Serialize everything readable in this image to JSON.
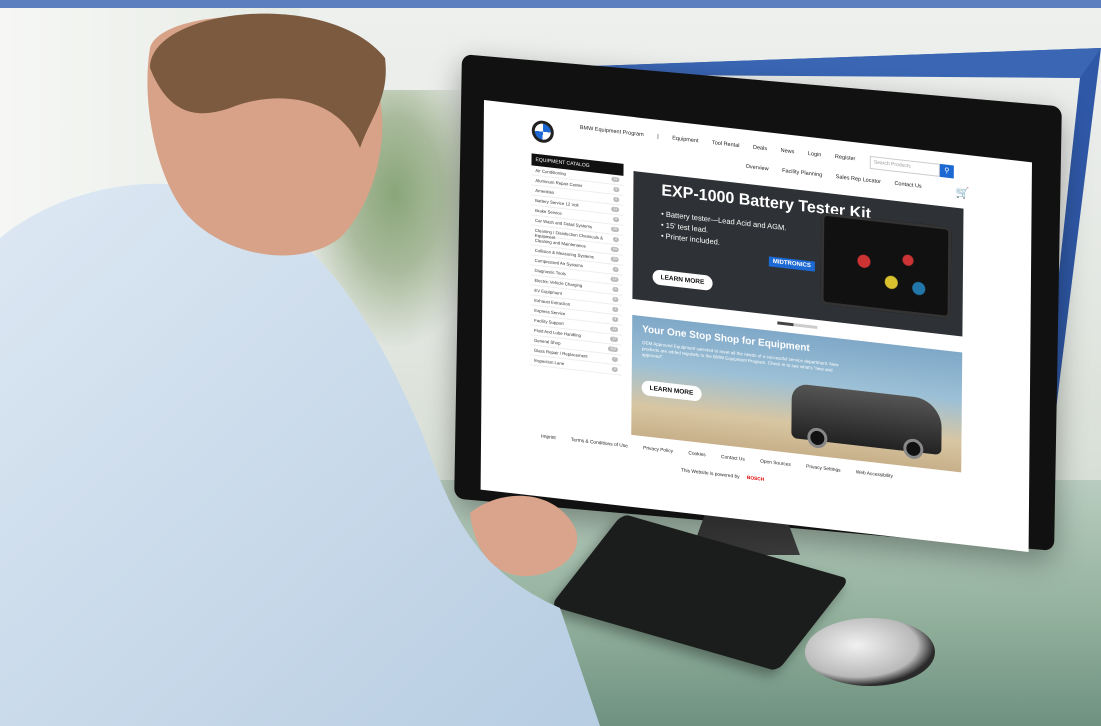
{
  "colors": {
    "accent": "#1c69d4",
    "frame": "#5b7fbf",
    "hero_dark": "#2e3135"
  },
  "site": {
    "nav_primary": [
      "BMW Equipment Program",
      "|",
      "Equipment",
      "Tool Rental",
      "Deals",
      "News",
      "Login",
      "Register"
    ],
    "search_placeholder": "Search Products",
    "search_icon": "search-icon",
    "nav_secondary": [
      "Overview",
      "Facility Planning",
      "Sales Rep Locator",
      "Contact Us"
    ],
    "cart_icon": "cart-icon"
  },
  "catalog": {
    "title": "EQUIPMENT CATALOG",
    "items": [
      {
        "label": "Air Conditioning",
        "count": "22"
      },
      {
        "label": "Aluminum Repair Center",
        "count": "9"
      },
      {
        "label": "Amenities",
        "count": "6"
      },
      {
        "label": "Battery Service 12 Volt",
        "count": "11"
      },
      {
        "label": "Brake Service",
        "count": "8"
      },
      {
        "label": "Car Wash and Detail Systems",
        "count": "25"
      },
      {
        "label": "Cleaning / Disinfection Chemicals & Equipment",
        "count": "2"
      },
      {
        "label": "Cleaning and Maintenance",
        "count": "44"
      },
      {
        "label": "Collision & Measuring Systems",
        "count": "23"
      },
      {
        "label": "Compressed Air Systems",
        "count": "4"
      },
      {
        "label": "Diagnostic Tools",
        "count": "12"
      },
      {
        "label": "Electric Vehicle Charging",
        "count": "6"
      },
      {
        "label": "EV Equipment",
        "count": "8"
      },
      {
        "label": "Exhaust Extraction",
        "count": "2"
      },
      {
        "label": "Express Service",
        "count": "9"
      },
      {
        "label": "Facility Support",
        "count": "11"
      },
      {
        "label": "Fluid And Lube Handling",
        "count": "17"
      },
      {
        "label": "General Shop",
        "count": "112"
      },
      {
        "label": "Glass Repair / Replacement",
        "count": "7"
      },
      {
        "label": "Inspection Lane",
        "count": "2"
      }
    ]
  },
  "hero_battery": {
    "title": "EXP-1000 Battery Tester Kit",
    "bullets": [
      "Battery tester—Lead Acid and AGM.",
      "15' test lead.",
      "Printer included."
    ],
    "brand": "MIDTRONICS",
    "cta": "LEARN MORE"
  },
  "hero_shop": {
    "title": "Your One Stop Shop for Equipment",
    "text": "OEM Approved Equipment selected to meet all the needs of a successful service department. New products are added regularly to the BMW Equipment Program. Check in to see what's \"new and approved\".",
    "cta": "LEARN MORE"
  },
  "footer": {
    "links": [
      "Imprint",
      "Terms & Conditions of Use",
      "Privacy Policy",
      "Cookies",
      "Contact Us",
      "Open Sources",
      "Privacy Settings",
      "Web Accessibility"
    ],
    "powered_text": "This Website is powered by",
    "powered_brand": "BOSCH"
  }
}
